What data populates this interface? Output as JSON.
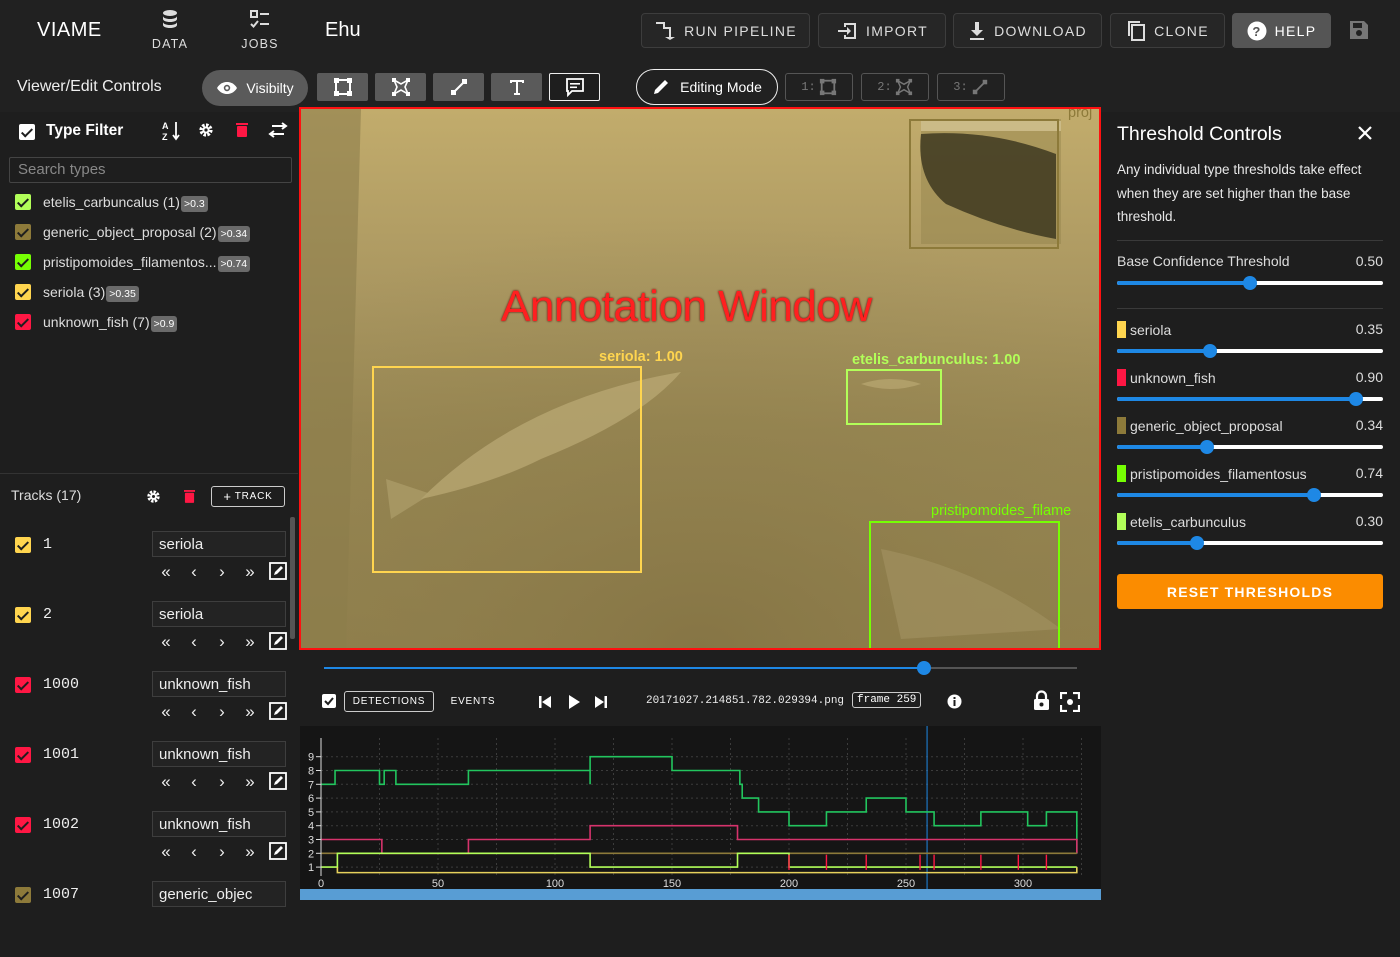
{
  "app": {
    "brand": "VIAME",
    "dataset_name": "Ehu"
  },
  "nav": [
    {
      "label": "DATA",
      "icon": "database-icon"
    },
    {
      "label": "JOBS",
      "icon": "jobs-icon"
    }
  ],
  "toolbar": {
    "run_pipeline": "RUN PIPELINE",
    "import": "IMPORT",
    "download": "DOWNLOAD",
    "clone": "CLONE",
    "help": "HELP"
  },
  "controls": {
    "label": "Viewer/Edit Controls",
    "visibility": "Visibilty",
    "editing_mode": "Editing Mode",
    "mode_keys": [
      "1:",
      "2:",
      "3:"
    ]
  },
  "type_filter": {
    "title": "Type Filter",
    "search_placeholder": "Search types",
    "types": [
      {
        "name": "etelis_carbuncalus (1)",
        "threshold": ">0.3",
        "color": "#b2ff59"
      },
      {
        "name": "generic_object_proposal (2)",
        "threshold": ">0.34",
        "color": "#8d7a3a"
      },
      {
        "name": "pristipomoides_filamentos...",
        "threshold": ">0.74",
        "color": "#76ff03"
      },
      {
        "name": "seriola (3)",
        "threshold": ">0.35",
        "color": "#ffd54f"
      },
      {
        "name": "unknown_fish (7)",
        "threshold": ">0.9",
        "color": "#ff1744"
      }
    ]
  },
  "tracks": {
    "header": "Tracks (17)",
    "add_label": "TRACK",
    "items": [
      {
        "id": "1",
        "type": "seriola",
        "color": "#ffd54f"
      },
      {
        "id": "2",
        "type": "seriola",
        "color": "#ffd54f"
      },
      {
        "id": "1000",
        "type": "unknown_fish",
        "color": "#ff1744"
      },
      {
        "id": "1001",
        "type": "unknown_fish",
        "color": "#ff1744"
      },
      {
        "id": "1002",
        "type": "unknown_fish",
        "color": "#ff1744"
      },
      {
        "id": "1007",
        "type": "generic_objec",
        "color": "#8d7a3a"
      }
    ]
  },
  "annotation": {
    "title": "Annotation Window",
    "labels": {
      "seriola": "seriola: 1.00",
      "etelis": "etelis_carbunculus: 1.00",
      "pristi": "pristipomoides_filame",
      "proposal": "proj"
    }
  },
  "player": {
    "detections": "DETECTIONS",
    "events": "EVENTS",
    "filename": "20171027.214851.782.029394.png",
    "frame": "frame 259"
  },
  "timeline_chart": {
    "y_ticks": [
      "9",
      "8",
      "7",
      "6",
      "5",
      "4",
      "3",
      "2",
      "1"
    ],
    "x_ticks": [
      "0",
      "50",
      "100",
      "150",
      "200",
      "250",
      "300"
    ]
  },
  "threshold": {
    "title": "Threshold Controls",
    "description": "Any individual type thresholds take effect when they are set higher than the base threshold.",
    "base_label": "Base Confidence Threshold",
    "base_value": "0.50",
    "base_fraction": 0.5,
    "reset_label": "RESET THRESHOLDS",
    "items": [
      {
        "name": "seriola",
        "value": "0.35",
        "fraction": 0.35,
        "color": "#ffd54f"
      },
      {
        "name": "unknown_fish",
        "value": "0.90",
        "fraction": 0.9,
        "color": "#ff1744"
      },
      {
        "name": "generic_object_proposal",
        "value": "0.34",
        "fraction": 0.34,
        "color": "#8d7a3a"
      },
      {
        "name": "pristipomoides_filamentosus",
        "value": "0.74",
        "fraction": 0.74,
        "color": "#76ff03"
      },
      {
        "name": "etelis_carbunculus",
        "value": "0.30",
        "fraction": 0.3,
        "color": "#b2ff59"
      }
    ]
  }
}
